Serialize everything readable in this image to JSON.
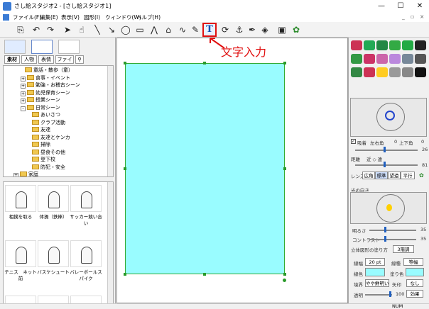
{
  "window": {
    "title": "さし絵スタジオ2 - [さし絵スタジオ1]",
    "minimize": "—",
    "maximize": "☐",
    "close": "✕"
  },
  "menu": [
    {
      "label": "ファイル(F)"
    },
    {
      "label": "編集(E)"
    },
    {
      "label": "表示(V)"
    },
    {
      "label": "図形(I)"
    },
    {
      "label": "ウィンドウ(W)"
    },
    {
      "label": "ヘルプ(H)"
    }
  ],
  "toolbar": {
    "text_tool_glyph": "T"
  },
  "annotation": {
    "text": "文字入力"
  },
  "left": {
    "tabs": [
      "素材",
      "人物",
      "表情",
      "ファイル"
    ],
    "tree": [
      {
        "label": "童話・散歩（童）",
        "indent": 30
      },
      {
        "label": "食事・イベント",
        "indent": 24,
        "exp": "+"
      },
      {
        "label": "勉強・お稽古シーン",
        "indent": 24,
        "exp": "+"
      },
      {
        "label": "幼児保育シーン",
        "indent": 24,
        "exp": "+"
      },
      {
        "label": "授業シーン",
        "indent": 24,
        "exp": "+"
      },
      {
        "label": "日常シーン",
        "indent": 24,
        "exp": "-"
      },
      {
        "label": "あいさつ",
        "indent": 40
      },
      {
        "label": "クラブ活動",
        "indent": 40
      },
      {
        "label": "友達",
        "indent": 40
      },
      {
        "label": "友達とケンカ",
        "indent": 40
      },
      {
        "label": "掃除",
        "indent": 40
      },
      {
        "label": "昼食その他",
        "indent": 40
      },
      {
        "label": "登下校",
        "indent": 40
      },
      {
        "label": "防犯・安全",
        "indent": 40
      },
      {
        "label": "家庭",
        "indent": 14,
        "exp": "+"
      }
    ],
    "thumbs": [
      {
        "label": "相撲を取る"
      },
      {
        "label": "体操（鉄棒）"
      },
      {
        "label": "サッカー競い合い"
      },
      {
        "label": "テニス　ネット前"
      },
      {
        "label": "バスケシュート"
      },
      {
        "label": "バレーボールスパイク"
      }
    ]
  },
  "right": {
    "checkbox_label": "吸着",
    "left_right_label": "左右角",
    "left_right_value": "0",
    "up_down_label": "上下角",
    "up_down_value": "0",
    "axis_end_value": "26",
    "distance_label": "距離",
    "near_far_label": "近 ◇ 遠",
    "distance_value": "81",
    "lens_label": "レンズ",
    "lens_options": [
      "広角",
      "標準",
      "望遠",
      "平行"
    ],
    "light_label": "光の向き",
    "brightness_label": "明るさ",
    "brightness_value": "35",
    "contrast_label": "コントラスト",
    "contrast_value": "35",
    "stereo_label": "立体図形の塗り方",
    "stereo_value": "3階調",
    "line_width_label": "線幅",
    "line_width_value": "20 pt",
    "line_type_label": "線種",
    "line_type_value": "等幅",
    "line_color_label": "線色",
    "fill_color_label": "塗り色",
    "border_label": "境界",
    "border_value": "やや鮮明い",
    "arrow_label": "矢印",
    "arrow_value": "なし",
    "opacity_label": "透明",
    "opacity_value": "100",
    "effect_label": "効果",
    "fill_color": "#99fcff",
    "line_color": "#99fcff"
  },
  "status": {
    "num": "NUM"
  }
}
